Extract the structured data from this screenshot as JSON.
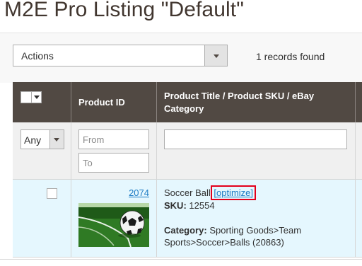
{
  "page": {
    "title": "M2E Pro Listing \"Default\""
  },
  "toolbar": {
    "actions_label": "Actions",
    "records_found": "1 records found"
  },
  "grid": {
    "columns": {
      "product_id": "Product ID",
      "product_title": "Product Title / Product SKU / eBay Category"
    },
    "filters": {
      "any_value": "Any",
      "from_placeholder": "From",
      "to_placeholder": "To",
      "title_value": ""
    },
    "rows": [
      {
        "product_id": "2074",
        "title": "Soccer Ball",
        "optimize_link": "[optimize]",
        "sku_label": "SKU:",
        "sku_value": "12554",
        "category_label": "Category:",
        "category_value": "Sporting Goods>Team Sports>Soccer>Balls (20863)"
      }
    ]
  },
  "colors": {
    "header_bg": "#514943",
    "row_bg": "#e5f7fe",
    "link": "#1979c3",
    "highlight": "#e3001b"
  }
}
